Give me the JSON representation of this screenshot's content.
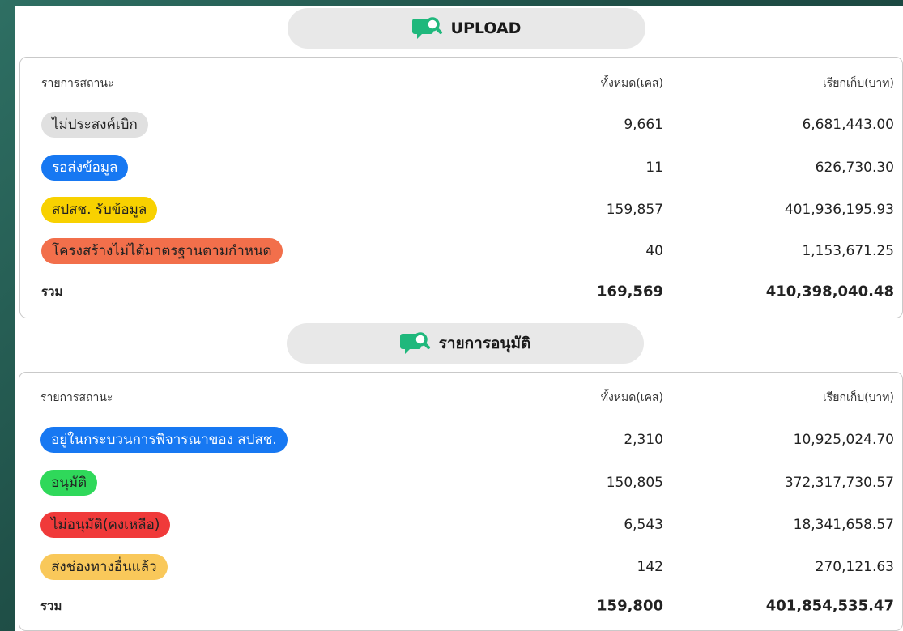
{
  "colors": {
    "gray_pill": "#e0e0e0",
    "blue_pill": "#1778f2",
    "yellow_pill": "#f8d100",
    "orange_pill": "#f26f4b",
    "green_pill": "#2fd85a",
    "red_pill": "#f03a3a",
    "light_orange_pill": "#f9c85a",
    "icon_green": "#1fb87c"
  },
  "upload": {
    "title": "UPLOAD",
    "icon": "chat-search-icon",
    "header": {
      "status": "รายการสถานะ",
      "count": "ทั้งหมด(เคส)",
      "amount": "เรียกเก็บ(บาท)"
    },
    "rows": [
      {
        "status": "ไม่ประสงค์เบิก",
        "count": "9,661",
        "amount": "6,681,443.00"
      },
      {
        "status": "รอส่งข้อมูล",
        "count": "11",
        "amount": "626,730.30"
      },
      {
        "status": "สปสช. รับข้อมูล",
        "count": "159,857",
        "amount": "401,936,195.93"
      },
      {
        "status": "โครงสร้างไม่ได้มาตรฐานตามกำหนด",
        "count": "40",
        "amount": "1,153,671.25"
      }
    ],
    "total": {
      "label": "รวม",
      "count": "169,569",
      "amount": "410,398,040.48"
    }
  },
  "approval": {
    "title": "รายการอนุมัติ",
    "icon": "chat-search-icon",
    "header": {
      "status": "รายการสถานะ",
      "count": "ทั้งหมด(เคส)",
      "amount": "เรียกเก็บ(บาท)"
    },
    "rows": [
      {
        "status": "อยู่ในกระบวนการพิจารณาของ สปสช.",
        "count": "2,310",
        "amount": "10,925,024.70"
      },
      {
        "status": "อนุมัติ",
        "count": "150,805",
        "amount": "372,317,730.57"
      },
      {
        "status": "ไม่อนุมัติ(คงเหลือ)",
        "count": "6,543",
        "amount": "18,341,658.57"
      },
      {
        "status": "ส่งช่องทางอื่นแล้ว",
        "count": "142",
        "amount": "270,121.63"
      }
    ],
    "total": {
      "label": "รวม",
      "count": "159,800",
      "amount": "401,854,535.47"
    }
  }
}
